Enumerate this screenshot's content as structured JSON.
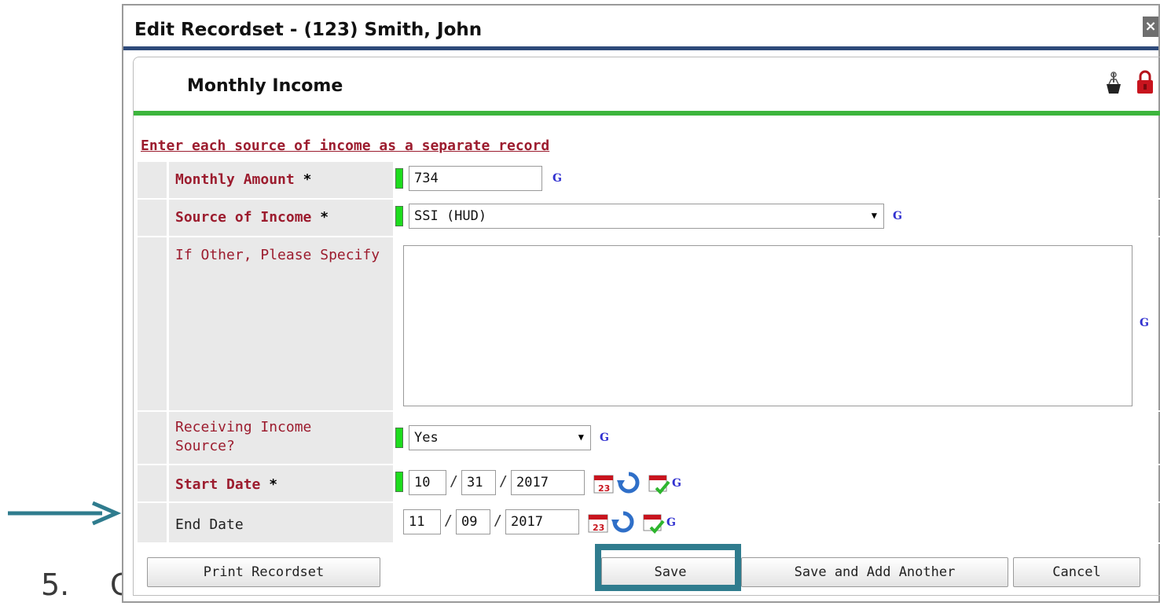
{
  "background": {
    "step_number": "5.",
    "step_text_partial": "C"
  },
  "dialog": {
    "title": "Edit Recordset - (123) Smith, John",
    "close_glyph": "×"
  },
  "panel": {
    "title": "Monthly Income",
    "instruction": "Enter each source of income as a separate record"
  },
  "form": {
    "monthly_amount": {
      "label": "Monthly Amount",
      "required": "*",
      "value": "734"
    },
    "source_of_income": {
      "label": "Source of Income",
      "required": "*",
      "value": "SSI (HUD)"
    },
    "other_specify": {
      "label": "If Other, Please Specify",
      "value": ""
    },
    "receiving_income": {
      "label": "Receiving Income Source?",
      "value": "Yes"
    },
    "start_date": {
      "label": "Start Date",
      "required": "*",
      "month": "10",
      "day": "31",
      "year": "2017"
    },
    "end_date": {
      "label": "End Date",
      "month": "11",
      "day": "09",
      "year": "2017"
    },
    "g_label": "G",
    "date_separator": "/",
    "select_arrow": "▼"
  },
  "buttons": {
    "print": "Print Recordset",
    "save": "Save",
    "save_add": "Save and Add Another",
    "cancel": "Cancel"
  },
  "colors": {
    "label_red": "#9c1c2e",
    "accent_green": "#3db53d",
    "title_bar_navy": "#2e4a7a",
    "highlight_teal": "#2f7c8e"
  }
}
